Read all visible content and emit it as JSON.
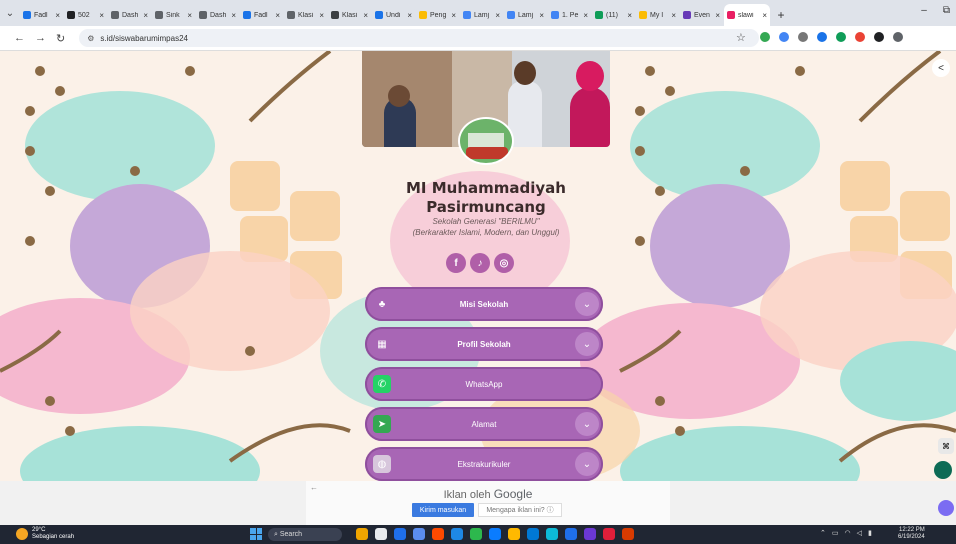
{
  "browser": {
    "tabs": [
      {
        "title": "Fadl",
        "color": "#1a73e8"
      },
      {
        "title": "502",
        "color": "#202124"
      },
      {
        "title": "Dash",
        "color": "#5f6368"
      },
      {
        "title": "Sink",
        "color": "#5f6368"
      },
      {
        "title": "Dash",
        "color": "#5f6368"
      },
      {
        "title": "Fadl",
        "color": "#1a73e8"
      },
      {
        "title": "Klasi",
        "color": "#5f6368"
      },
      {
        "title": "Klasi",
        "color": "#3c4043"
      },
      {
        "title": "Undi",
        "color": "#1a73e8"
      },
      {
        "title": "Peng",
        "color": "#fbbc04"
      },
      {
        "title": "Lamj",
        "color": "#4285f4"
      },
      {
        "title": "Lamj",
        "color": "#4285f4"
      },
      {
        "title": "1. Pe",
        "color": "#4285f4"
      },
      {
        "title": "(11)",
        "color": "#0f9d58"
      },
      {
        "title": "My I",
        "color": "#fbbc04"
      },
      {
        "title": "Even",
        "color": "#673ab7"
      },
      {
        "title": "slawi",
        "color": "#e91e63",
        "active": true
      }
    ],
    "url": "s.id/siswabarumimpas24",
    "extension_colors": [
      "#34a853",
      "#4285f4",
      "#777777",
      "#1a73e8",
      "#0f9d58",
      "#ea4335",
      "#202124",
      "#5f6368"
    ]
  },
  "profile": {
    "name": "MI Muhammadiyah Pasirmuncang",
    "tagline1": "Sekolah Generasi \"BERILMU\"",
    "tagline2": "(Berkarakter Islami, Modern, dan Unggul)",
    "socials": [
      {
        "name": "facebook-icon",
        "glyph": "f"
      },
      {
        "name": "tiktok-icon",
        "glyph": "♪"
      },
      {
        "name": "instagram-icon",
        "glyph": "◎"
      }
    ]
  },
  "links": [
    {
      "label": "Misi Sekolah",
      "bold": true,
      "chevron": true,
      "icon": "♣",
      "iconbg": "transparent"
    },
    {
      "label": "Profil Sekolah",
      "bold": true,
      "chevron": true,
      "icon": "▦",
      "iconbg": "transparent"
    },
    {
      "label": "WhatsApp",
      "bold": false,
      "chevron": false,
      "icon": "✆",
      "iconbg": "#25d366"
    },
    {
      "label": "Alamat",
      "bold": false,
      "chevron": true,
      "icon": "➤",
      "iconbg": "#34a853"
    },
    {
      "label": "Ekstrakurikuler",
      "bold": false,
      "chevron": true,
      "icon": "◍",
      "iconbg": "#d7c6dc"
    }
  ],
  "ad": {
    "label": "Iklan oleh",
    "brand": "Google",
    "send_label": "Kirim masukan",
    "why_label": "Mengapa iklan ini? ⓘ"
  },
  "taskbar": {
    "temp": "29°C",
    "weather": "Sebagian cerah",
    "search_placeholder": "Search",
    "time": "12:22 PM",
    "date": "6/19/2024",
    "app_colors": [
      "#f0a500",
      "#e8eaed",
      "#1f6feb",
      "#5b8def",
      "#ff4a00",
      "#1e88e5",
      "#2db84d",
      "#0a7cff",
      "#ffb900",
      "#0078d4",
      "#0dbbd7",
      "#1f6feb",
      "#6b38d4",
      "#e21f3a",
      "#d83b01"
    ]
  }
}
